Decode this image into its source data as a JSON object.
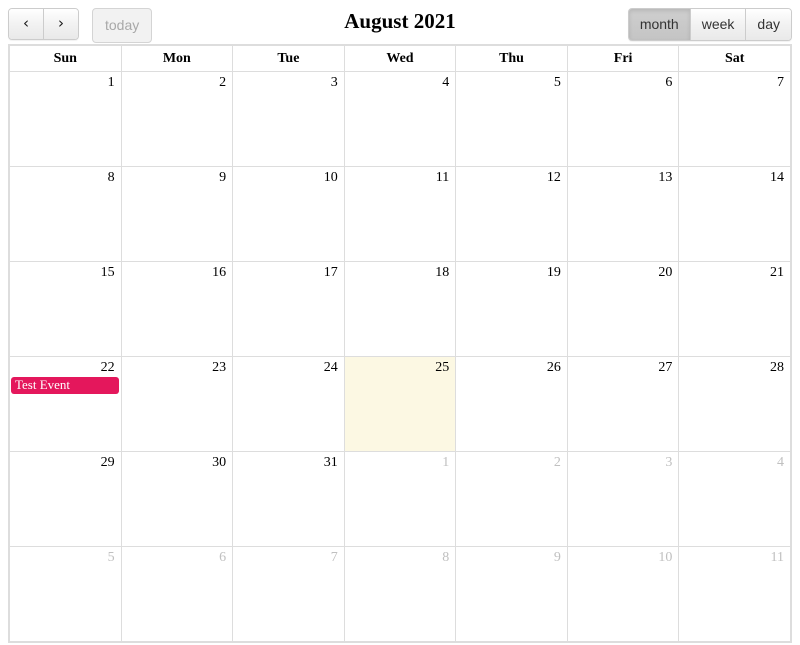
{
  "toolbar": {
    "prev_label": "‹",
    "next_label": "›",
    "today_label": "today",
    "title": "August 2021",
    "views": [
      {
        "key": "month",
        "label": "month",
        "active": true
      },
      {
        "key": "week",
        "label": "week",
        "active": false
      },
      {
        "key": "day",
        "label": "day",
        "active": false
      }
    ]
  },
  "grid": {
    "day_headers": [
      "Sun",
      "Mon",
      "Tue",
      "Wed",
      "Thu",
      "Fri",
      "Sat"
    ],
    "weeks": [
      [
        {
          "num": "1",
          "other_month": false,
          "today": false,
          "events": []
        },
        {
          "num": "2",
          "other_month": false,
          "today": false,
          "events": []
        },
        {
          "num": "3",
          "other_month": false,
          "today": false,
          "events": []
        },
        {
          "num": "4",
          "other_month": false,
          "today": false,
          "events": []
        },
        {
          "num": "5",
          "other_month": false,
          "today": false,
          "events": []
        },
        {
          "num": "6",
          "other_month": false,
          "today": false,
          "events": []
        },
        {
          "num": "7",
          "other_month": false,
          "today": false,
          "events": []
        }
      ],
      [
        {
          "num": "8",
          "other_month": false,
          "today": false,
          "events": []
        },
        {
          "num": "9",
          "other_month": false,
          "today": false,
          "events": []
        },
        {
          "num": "10",
          "other_month": false,
          "today": false,
          "events": []
        },
        {
          "num": "11",
          "other_month": false,
          "today": false,
          "events": []
        },
        {
          "num": "12",
          "other_month": false,
          "today": false,
          "events": []
        },
        {
          "num": "13",
          "other_month": false,
          "today": false,
          "events": []
        },
        {
          "num": "14",
          "other_month": false,
          "today": false,
          "events": []
        }
      ],
      [
        {
          "num": "15",
          "other_month": false,
          "today": false,
          "events": []
        },
        {
          "num": "16",
          "other_month": false,
          "today": false,
          "events": []
        },
        {
          "num": "17",
          "other_month": false,
          "today": false,
          "events": []
        },
        {
          "num": "18",
          "other_month": false,
          "today": false,
          "events": []
        },
        {
          "num": "19",
          "other_month": false,
          "today": false,
          "events": []
        },
        {
          "num": "20",
          "other_month": false,
          "today": false,
          "events": []
        },
        {
          "num": "21",
          "other_month": false,
          "today": false,
          "events": []
        }
      ],
      [
        {
          "num": "22",
          "other_month": false,
          "today": false,
          "events": [
            {
              "title": "Test Event",
              "color": "#e4175c"
            }
          ]
        },
        {
          "num": "23",
          "other_month": false,
          "today": false,
          "events": []
        },
        {
          "num": "24",
          "other_month": false,
          "today": false,
          "events": []
        },
        {
          "num": "25",
          "other_month": false,
          "today": true,
          "events": []
        },
        {
          "num": "26",
          "other_month": false,
          "today": false,
          "events": []
        },
        {
          "num": "27",
          "other_month": false,
          "today": false,
          "events": []
        },
        {
          "num": "28",
          "other_month": false,
          "today": false,
          "events": []
        }
      ],
      [
        {
          "num": "29",
          "other_month": false,
          "today": false,
          "events": []
        },
        {
          "num": "30",
          "other_month": false,
          "today": false,
          "events": []
        },
        {
          "num": "31",
          "other_month": false,
          "today": false,
          "events": []
        },
        {
          "num": "1",
          "other_month": true,
          "today": false,
          "events": []
        },
        {
          "num": "2",
          "other_month": true,
          "today": false,
          "events": []
        },
        {
          "num": "3",
          "other_month": true,
          "today": false,
          "events": []
        },
        {
          "num": "4",
          "other_month": true,
          "today": false,
          "events": []
        }
      ],
      [
        {
          "num": "5",
          "other_month": true,
          "today": false,
          "events": []
        },
        {
          "num": "6",
          "other_month": true,
          "today": false,
          "events": []
        },
        {
          "num": "7",
          "other_month": true,
          "today": false,
          "events": []
        },
        {
          "num": "8",
          "other_month": true,
          "today": false,
          "events": []
        },
        {
          "num": "9",
          "other_month": true,
          "today": false,
          "events": []
        },
        {
          "num": "10",
          "other_month": true,
          "today": false,
          "events": []
        },
        {
          "num": "11",
          "other_month": true,
          "today": false,
          "events": []
        }
      ]
    ]
  },
  "colors": {
    "event_accent": "#e4175c",
    "today_highlight": "#fcf8e3",
    "border": "#dddddd",
    "other_month_text": "#c0c0c0"
  }
}
